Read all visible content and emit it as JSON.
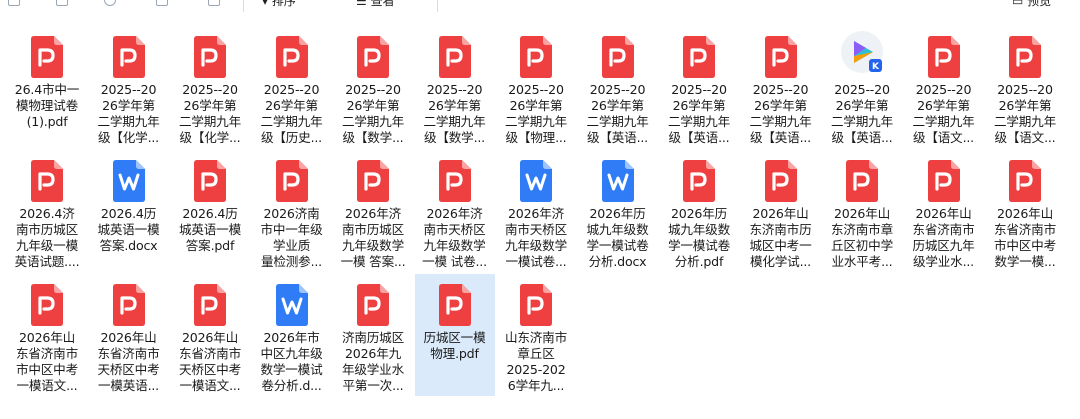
{
  "toolbar": {
    "sort_label": "排序",
    "view_label": "查看",
    "preview_label": "预览"
  },
  "files": [
    {
      "type": "pdf",
      "name": "26.4市中一\n模物理试卷\n(1).pdf"
    },
    {
      "type": "pdf",
      "name": "2025--20\n26学年第\n二学期九年\n级【化学..."
    },
    {
      "type": "pdf",
      "name": "2025--20\n26学年第\n二学期九年\n级【化学..."
    },
    {
      "type": "pdf",
      "name": "2025--20\n26学年第\n二学期九年\n级【历史..."
    },
    {
      "type": "pdf",
      "name": "2025--20\n26学年第\n二学期九年\n级【数学..."
    },
    {
      "type": "pdf",
      "name": "2025--20\n26学年第\n二学期九年\n级【数学..."
    },
    {
      "type": "pdf",
      "name": "2025--20\n26学年第\n二学期九年\n级【物理..."
    },
    {
      "type": "pdf",
      "name": "2025--20\n26学年第\n二学期九年\n级【英语..."
    },
    {
      "type": "pdf",
      "name": "2025--20\n26学年第\n二学期九年\n级【英语..."
    },
    {
      "type": "pdf",
      "name": "2025--20\n26学年第\n二学期九年\n级【英语..."
    },
    {
      "type": "video",
      "name": "2025--20\n26学年第\n二学期九年\n级【英语..."
    },
    {
      "type": "pdf",
      "name": "2025--20\n26学年第\n二学期九年\n级【语文..."
    },
    {
      "type": "pdf",
      "name": "2025--20\n26学年第\n二学期九年\n级【语文..."
    },
    {
      "type": "pdf",
      "name": "2026.4济\n南市历城区\n九年级一模\n英语试题...."
    },
    {
      "type": "word",
      "name": "2026.4历\n城英语一模\n答案.docx"
    },
    {
      "type": "pdf",
      "name": "2026.4历\n城英语一模\n答案.pdf"
    },
    {
      "type": "pdf",
      "name": "2026济南\n市中一年级\n学业质\n量检测参..."
    },
    {
      "type": "pdf",
      "name": "2026年济\n南市历城区\n九年级数学\n一模 答案..."
    },
    {
      "type": "pdf",
      "name": "2026年济\n南市天桥区\n九年级数学\n一模 试卷..."
    },
    {
      "type": "word",
      "name": "2026年济\n南市天桥区\n九年级数学\n一模试卷..."
    },
    {
      "type": "word",
      "name": "2026年历\n城九年级数\n学一模试卷\n分析.docx"
    },
    {
      "type": "pdf",
      "name": "2026年历\n城九年级数\n学一模试卷\n分析.pdf"
    },
    {
      "type": "pdf",
      "name": "2026年山\n东济南市历\n城区中考一\n模化学试..."
    },
    {
      "type": "pdf",
      "name": "2026年山\n东济南市章\n丘区初中学\n业水平考..."
    },
    {
      "type": "pdf",
      "name": "2026年山\n东省济南市\n历城区九年\n级学业水..."
    },
    {
      "type": "pdf",
      "name": "2026年山\n东省济南市\n市中区中考\n数学一模..."
    },
    {
      "type": "pdf",
      "name": "2026年山\n东省济南市\n市中区中考\n一模语文..."
    },
    {
      "type": "pdf",
      "name": "2026年山\n东省济南市\n天桥区中考\n一模英语..."
    },
    {
      "type": "pdf",
      "name": "2026年山\n东省济南市\n天桥区中考\n一模语文..."
    },
    {
      "type": "word",
      "name": "2026年市\n中区九年级\n数学一模试\n卷分析.d..."
    },
    {
      "type": "pdf",
      "name": "济南历城区\n2026年九\n年级学业水\n平第一次..."
    },
    {
      "type": "pdf",
      "name": "历城区一模\n物理.pdf",
      "selected": true
    },
    {
      "type": "pdf",
      "name": "山东济南市\n章丘区\n2025-202\n6学年九..."
    }
  ]
}
